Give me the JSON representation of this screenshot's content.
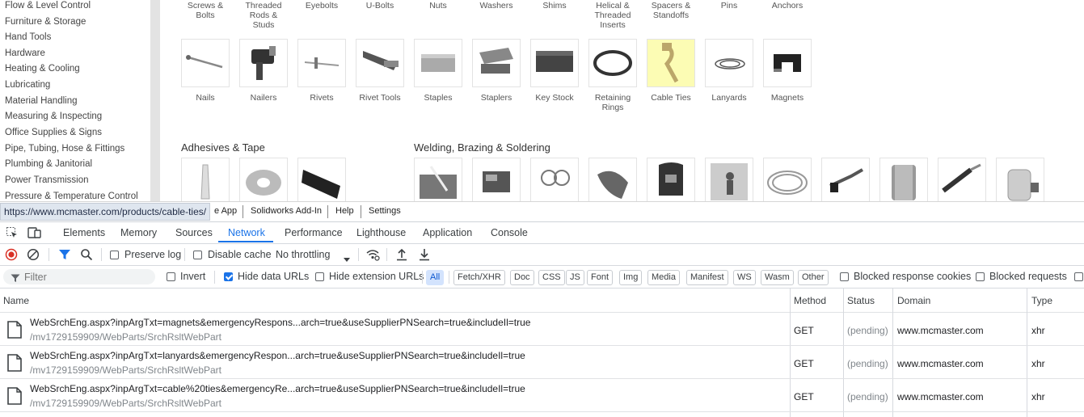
{
  "sidebar": {
    "categories": [
      "Flow & Level Control",
      "Furniture & Storage",
      "Hand Tools",
      "Hardware",
      "Heating & Cooling",
      "Lubricating",
      "Material Handling",
      "Measuring & Inspecting",
      "Office Supplies & Signs",
      "Pipe, Tubing, Hose & Fittings",
      "Plumbing & Janitorial",
      "Power Transmission",
      "Pressure & Temperature Control"
    ]
  },
  "products": {
    "row1_labels": [
      "Screws &\nBolts",
      "Threaded\nRods &\nStuds",
      "Eyebolts",
      "U-Bolts",
      "Nuts",
      "Washers",
      "Shims",
      "Helical &\nThreaded\nInserts",
      "Spacers &\nStandoffs",
      "Pins",
      "Anchors"
    ],
    "row2_labels": [
      "Nails",
      "Nailers",
      "Rivets",
      "Rivet Tools",
      "Staples",
      "Staplers",
      "Key Stock",
      "Retaining\nRings",
      "Cable Ties",
      "Lanyards",
      "Magnets"
    ],
    "highlighted": "Cable Ties"
  },
  "sections": {
    "adhesives": "Adhesives & Tape",
    "welding": "Welding, Brazing & Soldering"
  },
  "site_toolbar": {
    "status_url": "https://www.mcmaster.com/products/cable-ties/",
    "app_link": "e App",
    "solidworks": "Solidworks Add-In",
    "help": "Help",
    "settings": "Settings"
  },
  "devtools": {
    "tabs": [
      "Elements",
      "Memory",
      "Sources",
      "Network",
      "Performance",
      "Lighthouse",
      "Application",
      "Console"
    ],
    "active_tab": "Network",
    "toolbar": {
      "preserve_log": "Preserve log",
      "disable_cache": "Disable cache",
      "throttling": "No throttling"
    },
    "filter": {
      "placeholder": "Filter",
      "invert": "Invert",
      "hide_data_urls": "Hide data URLs",
      "hide_extension_urls": "Hide extension URLs",
      "types": [
        "All",
        "Fetch/XHR",
        "Doc",
        "CSS",
        "JS",
        "Font",
        "Img",
        "Media",
        "Manifest",
        "WS",
        "Wasm",
        "Other"
      ],
      "blocked_cookies": "Blocked response cookies",
      "blocked_requests": "Blocked requests"
    },
    "table": {
      "headers": {
        "name": "Name",
        "method": "Method",
        "status": "Status",
        "domain": "Domain",
        "type": "Type"
      },
      "rows": [
        {
          "name": "WebSrchEng.aspx?inpArgTxt=magnets&emergencyRespons...arch=true&useSupplierPNSearch=true&includeIl=true",
          "path": "/mv1729159909/WebParts/SrchRsltWebPart",
          "method": "GET",
          "status": "(pending)",
          "domain": "www.mcmaster.com",
          "type": "xhr"
        },
        {
          "name": "WebSrchEng.aspx?inpArgTxt=lanyards&emergencyRespon...arch=true&useSupplierPNSearch=true&includeIl=true",
          "path": "/mv1729159909/WebParts/SrchRsltWebPart",
          "method": "GET",
          "status": "(pending)",
          "domain": "www.mcmaster.com",
          "type": "xhr"
        },
        {
          "name": "WebSrchEng.aspx?inpArgTxt=cable%20ties&emergencyRe...arch=true&useSupplierPNSearch=true&includeIl=true",
          "path": "/mv1729159909/WebParts/SrchRsltWebPart",
          "method": "GET",
          "status": "(pending)",
          "domain": "www.mcmaster.com",
          "type": "xhr"
        }
      ]
    }
  }
}
